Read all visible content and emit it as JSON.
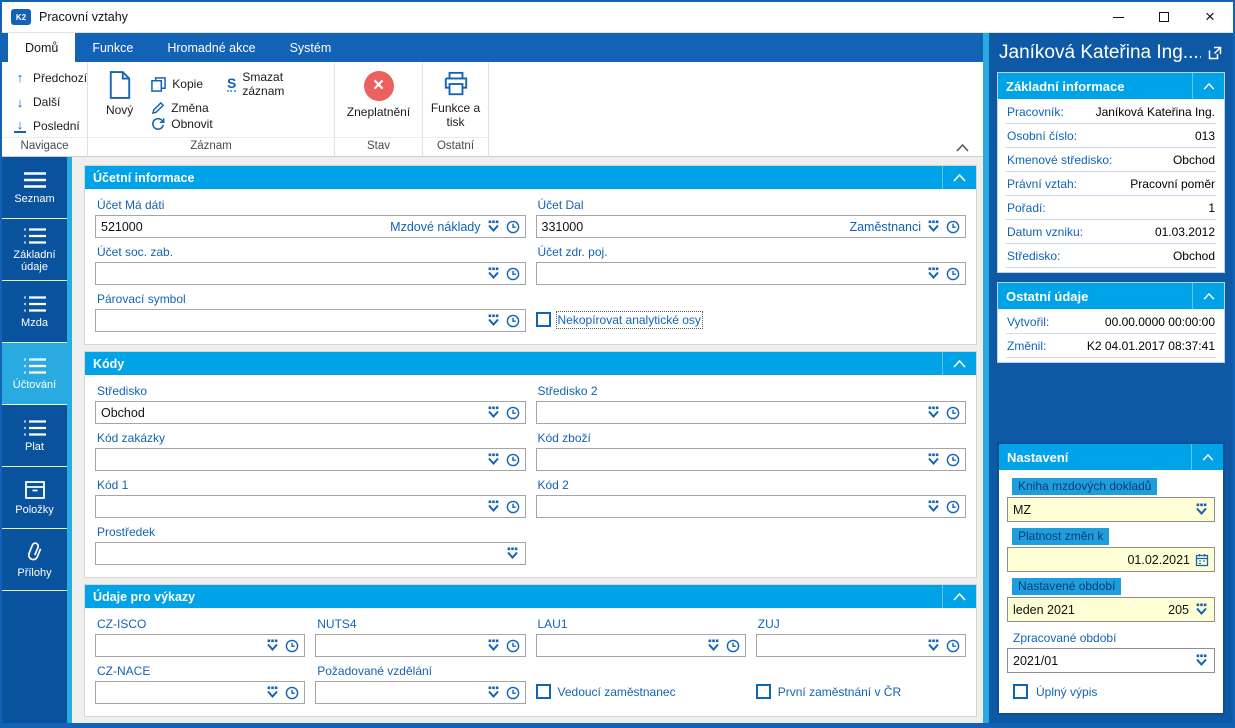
{
  "window": {
    "title": "Pracovní vztahy",
    "logo_text": "K2"
  },
  "tabs": [
    {
      "label": "Domů",
      "active": true
    },
    {
      "label": "Funkce",
      "active": false
    },
    {
      "label": "Hromadné akce",
      "active": false
    },
    {
      "label": "Systém",
      "active": false
    }
  ],
  "ribbon": {
    "navigace": {
      "label": "Navigace",
      "predchozi": "Předchozí",
      "dalsi": "Další",
      "posledni": "Poslední"
    },
    "zaznam": {
      "label": "Záznam",
      "novy": "Nový",
      "kopie": "Kopie",
      "zmena": "Změna",
      "obnovit": "Obnovit",
      "smazat": "Smazat záznam",
      "smazat_icon": "S"
    },
    "stav": {
      "label": "Stav",
      "zneplatneni": "Zneplatnění"
    },
    "ostatni": {
      "label": "Ostatní",
      "funkce_tisk": "Funkce a tisk"
    }
  },
  "sidebar": [
    {
      "label": "Seznam",
      "icon": "menu",
      "active": false
    },
    {
      "label": "Základní údaje",
      "icon": "list",
      "active": false
    },
    {
      "label": "Mzda",
      "icon": "list",
      "active": false
    },
    {
      "label": "Účtování",
      "icon": "list",
      "active": true
    },
    {
      "label": "Plat",
      "icon": "list",
      "active": false
    },
    {
      "label": "Položky",
      "icon": "box",
      "active": false
    },
    {
      "label": "Přílohy",
      "icon": "paperclip",
      "active": false
    }
  ],
  "form": {
    "ucetni": {
      "title": "Účetní informace",
      "ucet_ma_dati": {
        "label": "Účet Má dáti",
        "value": "521000",
        "desc": "Mzdové náklady"
      },
      "ucet_dal": {
        "label": "Účet Dal",
        "value": "331000",
        "desc": "Zaměstnanci"
      },
      "ucet_soc": {
        "label": "Účet soc. zab.",
        "value": ""
      },
      "ucet_zdr": {
        "label": "Účet zdr. poj.",
        "value": ""
      },
      "parovaci": {
        "label": "Párovací symbol",
        "value": ""
      },
      "nekopirovat": {
        "label": "Nekopírovat analytické osy",
        "checked": false
      }
    },
    "kody": {
      "title": "Kódy",
      "stredisko": {
        "label": "Středisko",
        "value": "Obchod"
      },
      "stredisko2": {
        "label": "Středisko 2",
        "value": ""
      },
      "kod_zakazky": {
        "label": "Kód zakázky",
        "value": ""
      },
      "kod_zbozi": {
        "label": "Kód zboží",
        "value": ""
      },
      "kod1": {
        "label": "Kód 1",
        "value": ""
      },
      "kod2": {
        "label": "Kód 2",
        "value": ""
      },
      "prostredek": {
        "label": "Prostředek",
        "value": ""
      }
    },
    "vykazy": {
      "title": "Údaje pro výkazy",
      "cz_isco": {
        "label": "CZ-ISCO",
        "value": ""
      },
      "nuts4": {
        "label": "NUTS4",
        "value": ""
      },
      "lau1": {
        "label": "LAU1",
        "value": ""
      },
      "zuj": {
        "label": "ZUJ",
        "value": ""
      },
      "cz_nace": {
        "label": "CZ-NACE",
        "value": ""
      },
      "pozadovane_vzdelani": {
        "label": "Požadované vzdělání",
        "value": ""
      },
      "vedouci": {
        "label": "Vedoucí zaměstnanec",
        "checked": false
      },
      "prvni_zamestnani": {
        "label": "První zaměstnání v ČR",
        "checked": false
      }
    }
  },
  "right_panel": {
    "header": "Janíková Kateřina Ing....",
    "zakladni": {
      "title": "Základní informace",
      "rows": [
        {
          "label": "Pracovník:",
          "value": "Janíková Kateřina Ing."
        },
        {
          "label": "Osobní číslo:",
          "value": "013"
        },
        {
          "label": "Kmenové středisko:",
          "value": "Obchod"
        },
        {
          "label": "Právní vztah:",
          "value": "Pracovní poměr"
        },
        {
          "label": "Pořadí:",
          "value": "1"
        },
        {
          "label": "Datum vzniku:",
          "value": "01.03.2012"
        },
        {
          "label": "Středisko:",
          "value": "Obchod"
        }
      ]
    },
    "ostatni": {
      "title": "Ostatní údaje",
      "rows": [
        {
          "label": "Vytvořil:",
          "value": "00.00.0000 00:00:00"
        },
        {
          "label": "Změnil:",
          "value": "K2 04.01.2017 08:37:41"
        }
      ]
    },
    "nastaveni": {
      "title": "Nastavení",
      "kniha": {
        "label": "Kniha mzdových dokladů",
        "value": "MZ"
      },
      "platnost": {
        "label": "Platnost změn k",
        "value": "01.02.2021"
      },
      "obdobi": {
        "label": "Nastavené období",
        "value": "leden 2021",
        "number": "205"
      },
      "zpracovane": {
        "label": "Zpracované období",
        "value": "2021/01"
      },
      "uplny_vypis": {
        "label": "Úplný výpis",
        "checked": false
      }
    }
  },
  "colors": {
    "accent_blue": "#1263b5",
    "sidebar_blue": "#09539e",
    "highlight_cyan": "#29abe2",
    "section_header": "#00a2e8",
    "panel_background": "#0e59a6",
    "invalidate_red": "#e9625f",
    "input_yellow": "#ffffd6"
  }
}
